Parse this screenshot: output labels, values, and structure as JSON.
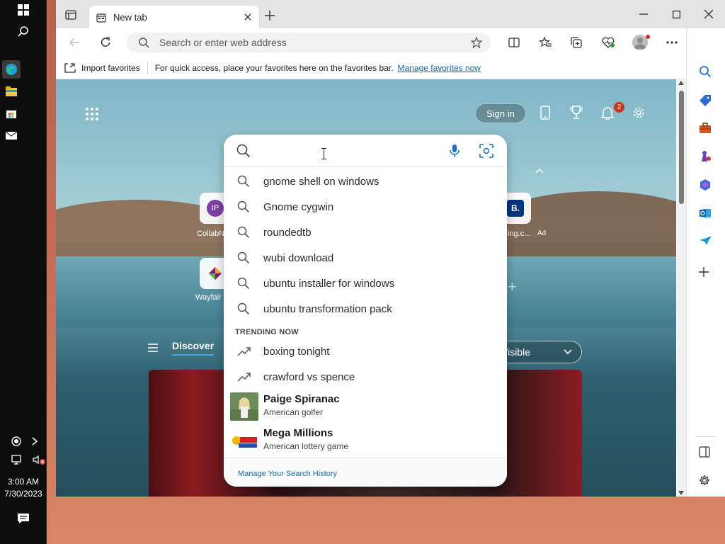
{
  "taskbar": {
    "clock_time": "3:00 AM",
    "clock_date": "7/30/2023"
  },
  "browser": {
    "tab_title": "New tab",
    "address_placeholder": "Search or enter web address",
    "favbar": {
      "import_label": "Import favorites",
      "hint_text": "For quick access, place your favorites here on the favorites bar.",
      "manage_link": "Manage favorites now"
    }
  },
  "newtab": {
    "signin_label": "Sign in",
    "notification_count": "2",
    "tiles": [
      {
        "label": "CollabN",
        "badge": "IP"
      },
      {
        "label": "ing.c...",
        "badge": "B.",
        "ad": "Ad"
      },
      {
        "label": "Wayfair"
      }
    ],
    "feed": {
      "discover_label": "Discover",
      "visible_label": "Visible"
    }
  },
  "search": {
    "query": "",
    "suggestions": [
      "gnome shell on windows",
      "Gnome cygwin",
      "roundedtb",
      "wubi download",
      "ubuntu installer for windows",
      "ubuntu transformation pack"
    ],
    "trending_header": "TRENDING NOW",
    "trending": [
      "boxing tonight",
      "crawford vs spence"
    ],
    "entities": [
      {
        "name": "Paige Spiranac",
        "desc": "American golfer"
      },
      {
        "name": "Mega Millions",
        "desc": "American lottery game"
      }
    ],
    "footer_link": "Manage Your Search History"
  },
  "colors": {
    "accent": "#0f6cbd",
    "desktop": "#c9705a",
    "badge_red": "#c8361d"
  }
}
